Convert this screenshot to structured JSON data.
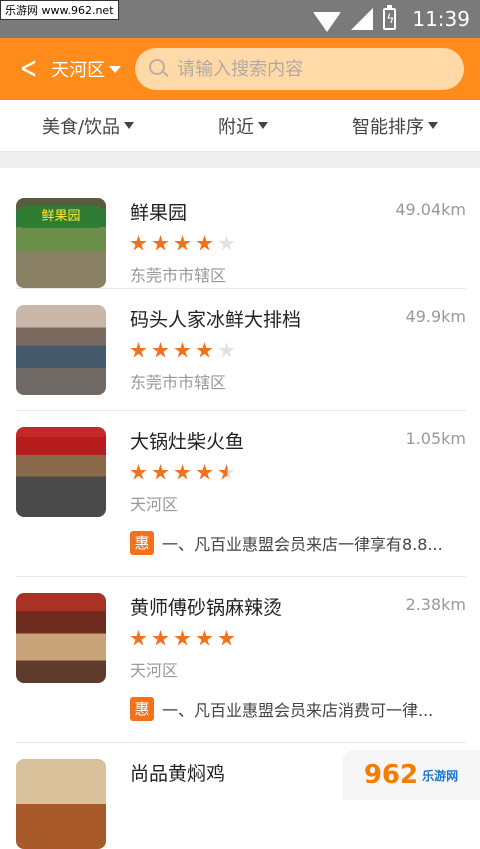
{
  "status_bar": {
    "watermark": "乐游网 www.962.net",
    "time": "11:39"
  },
  "header": {
    "back_icon": "chevron-left-icon",
    "district": "天河区",
    "search_placeholder": "请输入搜索内容",
    "accent_color": "#ff8c1a"
  },
  "filters": [
    {
      "label": "美食/饮品"
    },
    {
      "label": "附近"
    },
    {
      "label": "智能排序"
    }
  ],
  "shops": [
    {
      "name": "鲜果园",
      "distance": "49.04km",
      "rating": 4,
      "area": "东莞市市辖区",
      "promo": "",
      "sign": "鲜果园"
    },
    {
      "name": "码头人家冰鲜大排档",
      "distance": "49.9km",
      "rating": 4,
      "area": "东莞市市辖区",
      "promo": ""
    },
    {
      "name": "大锅灶柴火鱼",
      "distance": "1.05km",
      "rating": 4.5,
      "area": "天河区",
      "promo_badge": "惠",
      "promo": "一、凡百业惠盟会员来店一律享有8.8..."
    },
    {
      "name": "黄师傅砂锅麻辣烫",
      "distance": "2.38km",
      "rating": 5,
      "area": "天河区",
      "promo_badge": "惠",
      "promo": "一、凡百业惠盟会员来店消费可一律..."
    },
    {
      "name": "尚品黄焖鸡",
      "distance": "",
      "rating": 0,
      "area": "",
      "promo": ""
    }
  ],
  "watermark_logo": {
    "text": "962",
    "sub": "乐游网"
  }
}
